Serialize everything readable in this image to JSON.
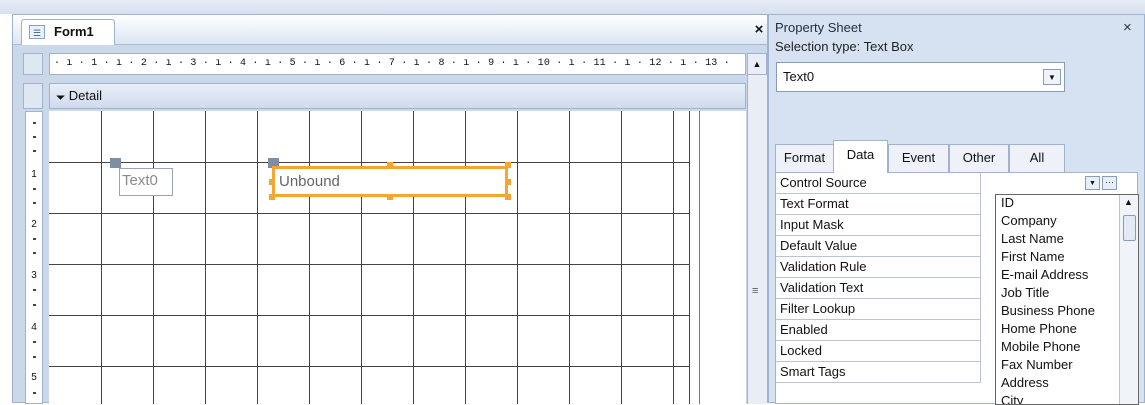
{
  "form": {
    "title": "Form1",
    "icon": "form-icon",
    "close": "×",
    "ruler_text": "· ı · 1 · ı · 2 · ı · 3 · ı · 4 · ı · 5 · ı · 6 · ı · 7 · ı · 8 · ı · 9 · ı · 10 · ı · 11 · ı · 12 · ı · 13 ·",
    "section_icon": "🞃",
    "section_label": "Detail",
    "vruler_numbers": [
      "1",
      "2",
      "3",
      "4",
      "5"
    ],
    "label_control_text": "Text0",
    "textbox_text": "Unbound"
  },
  "property_sheet": {
    "title": "Property Sheet",
    "close": "×",
    "selection_type": "Selection type:  Text Box",
    "selected_control": "Text0",
    "tabs": [
      "Format",
      "Data",
      "Event",
      "Other",
      "All"
    ],
    "active_tab": "Data",
    "properties": [
      "Control Source",
      "Text Format",
      "Input Mask",
      "Default Value",
      "Validation Rule",
      "Validation Text",
      "Filter Lookup",
      "Enabled",
      "Locked",
      "Smart Tags"
    ],
    "dropdown_options": [
      "ID",
      "Company",
      "Last Name",
      "First Name",
      "E-mail Address",
      "Job Title",
      "Business Phone",
      "Home Phone",
      "Mobile Phone",
      "Fax Number",
      "Address",
      "City"
    ]
  },
  "colors": {
    "selection_orange": "#f4a532",
    "chrome_blue": "#d6e2f2"
  }
}
